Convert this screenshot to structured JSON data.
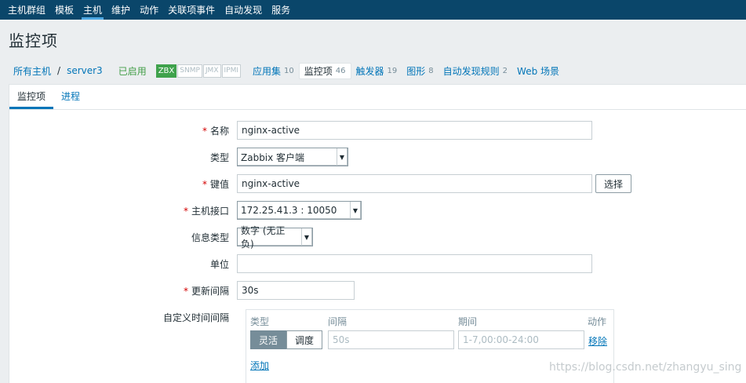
{
  "topnav": {
    "items": [
      "主机群组",
      "模板",
      "主机",
      "维护",
      "动作",
      "关联项事件",
      "自动发现",
      "服务"
    ]
  },
  "page": {
    "title": "监控项"
  },
  "hostnav": {
    "all_hosts": "所有主机",
    "separator": "/",
    "host": "server3",
    "status": "已启用",
    "availability": [
      "ZBX",
      "SNMP",
      "JMX",
      "IPMI"
    ],
    "tabs": [
      {
        "label": "应用集",
        "count": "10"
      },
      {
        "label": "监控项",
        "count": "46"
      },
      {
        "label": "触发器",
        "count": "19"
      },
      {
        "label": "图形",
        "count": "8"
      },
      {
        "label": "自动发现规则",
        "count": "2"
      },
      {
        "label": "Web 场景",
        "count": ""
      }
    ]
  },
  "subtabs": [
    "监控项",
    "进程"
  ],
  "form": {
    "name_label": "名称",
    "name_value": "nginx-active",
    "type_label": "类型",
    "type_value": "Zabbix 客户端",
    "key_label": "键值",
    "key_value": "nginx-active",
    "select_button": "选择",
    "interface_label": "主机接口",
    "interface_value": "172.25.41.3 : 10050",
    "info_type_label": "信息类型",
    "info_type_value": "数字 (无正负)",
    "units_label": "单位",
    "units_value": "",
    "interval_label": "更新间隔",
    "interval_value": "30s",
    "custom_label": "自定义时间间隔",
    "custom": {
      "col_type": "类型",
      "col_interval": "间隔",
      "col_period": "期间",
      "col_action": "动作",
      "flex": "灵活",
      "schedule": "调度",
      "interval_placeholder": "50s",
      "period_placeholder": "1-7,00:00-24:00",
      "remove": "移除",
      "add": "添加"
    }
  },
  "watermark": "https://blog.csdn.net/zhangyu_sing"
}
